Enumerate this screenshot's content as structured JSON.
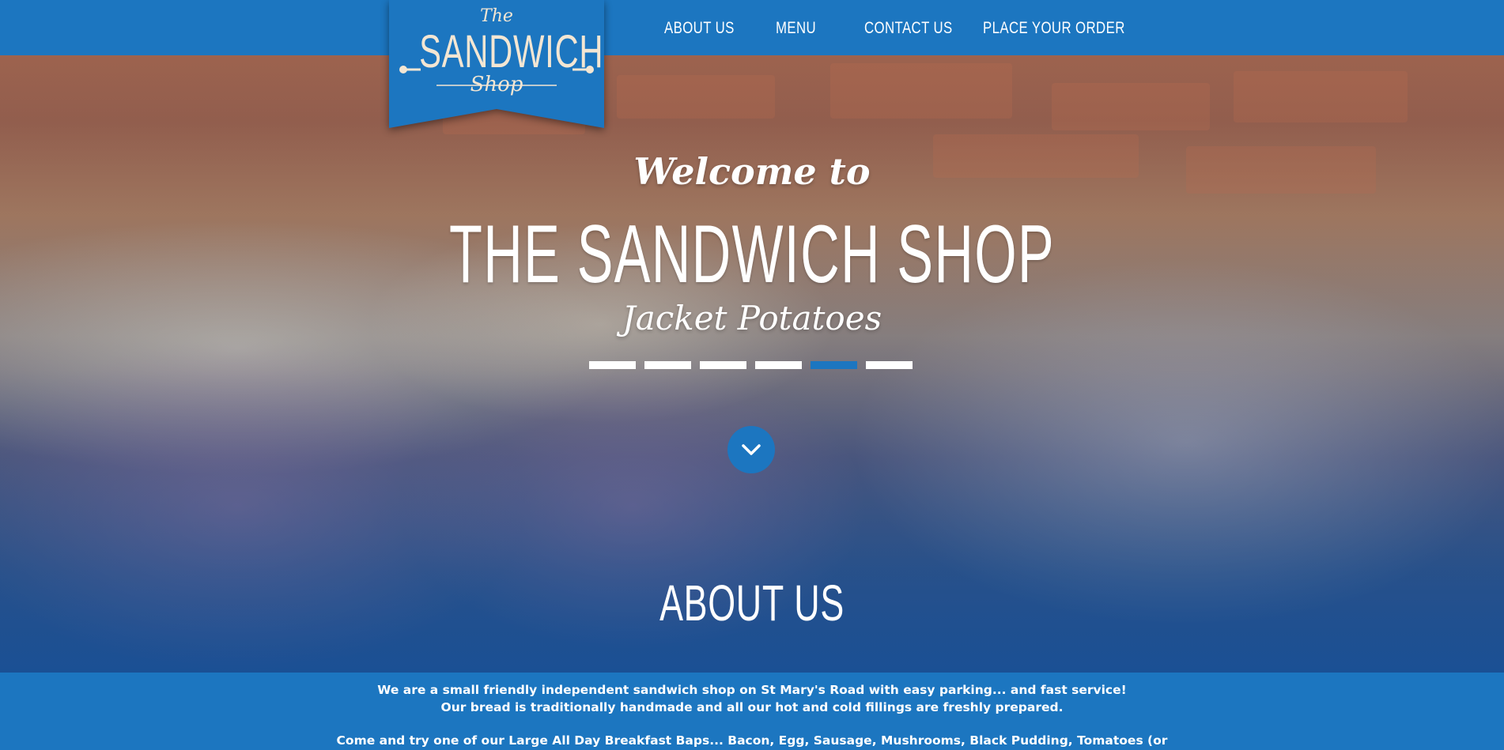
{
  "logo": {
    "the": "The",
    "main": "SANDWICH",
    "shop": "Shop"
  },
  "nav": {
    "items": [
      {
        "label": "ABOUT US"
      },
      {
        "label": "MENU"
      },
      {
        "label": "CONTACT US"
      },
      {
        "label": "PLACE YOUR ORDER"
      }
    ]
  },
  "hero": {
    "welcome": "Welcome to",
    "title": "THE SANDWICH SHOP",
    "caption": "Jacket Potatoes",
    "slides": {
      "count": 6,
      "active": 5
    }
  },
  "about": {
    "title": "ABOUT US",
    "line1": "We are a small friendly independent sandwich shop on St Mary's Road with easy parking... and fast service!",
    "line2": "Our bread is traditionally handmade and all our hot and cold fillings are freshly prepared.",
    "line3": "Come and try one of our Large All Day Breakfast Baps... Bacon, Egg, Sausage, Mushrooms, Black Pudding, Tomatoes (or"
  },
  "colors": {
    "brand_blue": "#1c76c0",
    "logo_cream": "#f3e6d3",
    "text": "#ffffff"
  },
  "icons": {
    "scroll": "chevron-down-icon"
  }
}
